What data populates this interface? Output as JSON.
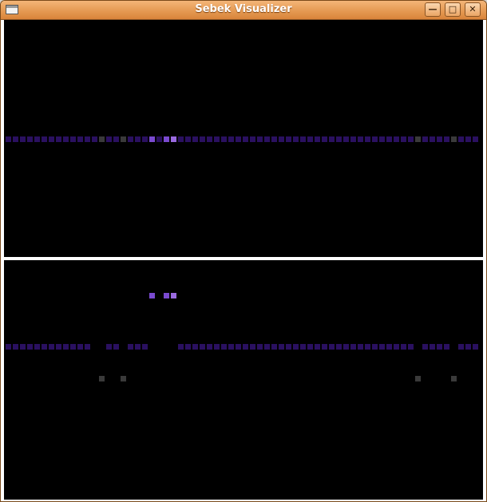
{
  "window": {
    "title": "Sebek Visualizer",
    "buttons": {
      "minimize_icon": "minimize-icon",
      "maximize_icon": "maximize-icon",
      "close_icon": "close-icon"
    }
  },
  "colors": {
    "background": "#000000",
    "row_default": "#2a1060",
    "gray": "#3a3a3a",
    "purple_mid": "#7a4ad0",
    "purple_bright": "#9a6ae0"
  },
  "visualizer": {
    "columns": 66,
    "top_pane": {
      "baseline_row_colors": {
        "default": "row_default",
        "13": "gray",
        "16": "gray",
        "20": "purple_mid",
        "22": "purple_mid",
        "23": "purple_bright",
        "57": "gray",
        "62": "gray"
      }
    },
    "bottom_pane": {
      "highlight_columns": [
        20,
        22,
        23
      ],
      "baseline_gap_columns": [
        12,
        15,
        20,
        22,
        23
      ],
      "gray_columns": [
        13,
        16,
        57,
        62
      ],
      "baseline_empty_extra": [
        21,
        13,
        16,
        57,
        62
      ]
    }
  }
}
